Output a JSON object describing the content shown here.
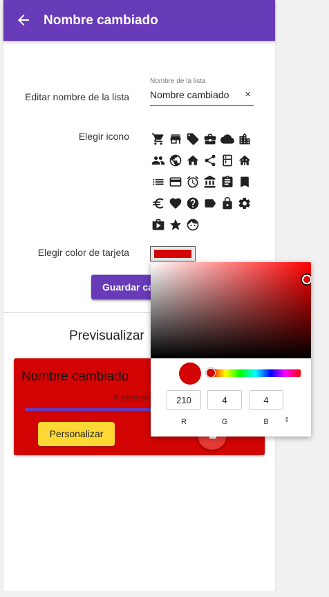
{
  "appbar": {
    "title": "Nombre cambiado",
    "back_icon": "arrow-back-icon"
  },
  "form": {
    "edit_name_label": "Editar nombre de la lista",
    "name_field": {
      "floating_label": "Nombre de la lista",
      "value": "Nombre cambiado",
      "clear_icon": "×"
    },
    "choose_icon_label": "Elegir icono",
    "icons": [
      "cart-icon",
      "store-icon",
      "tag-icon",
      "briefcase-icon",
      "cloud-icon",
      "building-icon",
      "people-icon",
      "globe-icon",
      "home-icon",
      "share-icon",
      "kitchen-icon",
      "house-icon",
      "list-icon",
      "card-icon",
      "alarm-icon",
      "bank-icon",
      "clipboard-icon",
      "bookmark-icon",
      "euro-icon",
      "heart-icon",
      "help-icon",
      "label-icon",
      "lock-icon",
      "settings-icon",
      "shop-play-icon",
      "star-icon",
      "face-icon"
    ],
    "choose_color_label": "Elegir color de tarjeta",
    "card_color": "#d20404",
    "save_label": "Guardar cambios"
  },
  "preview": {
    "title": "Previsualizar",
    "card_title": "Nombre cambiado",
    "count": "X elementos",
    "customize_label": "Personalizar",
    "accent_color": "#673ab7"
  },
  "picker": {
    "r": "210",
    "g": "4",
    "b": "4",
    "r_label": "R",
    "g_label": "G",
    "b_label": "B",
    "toggle": "⇕"
  }
}
